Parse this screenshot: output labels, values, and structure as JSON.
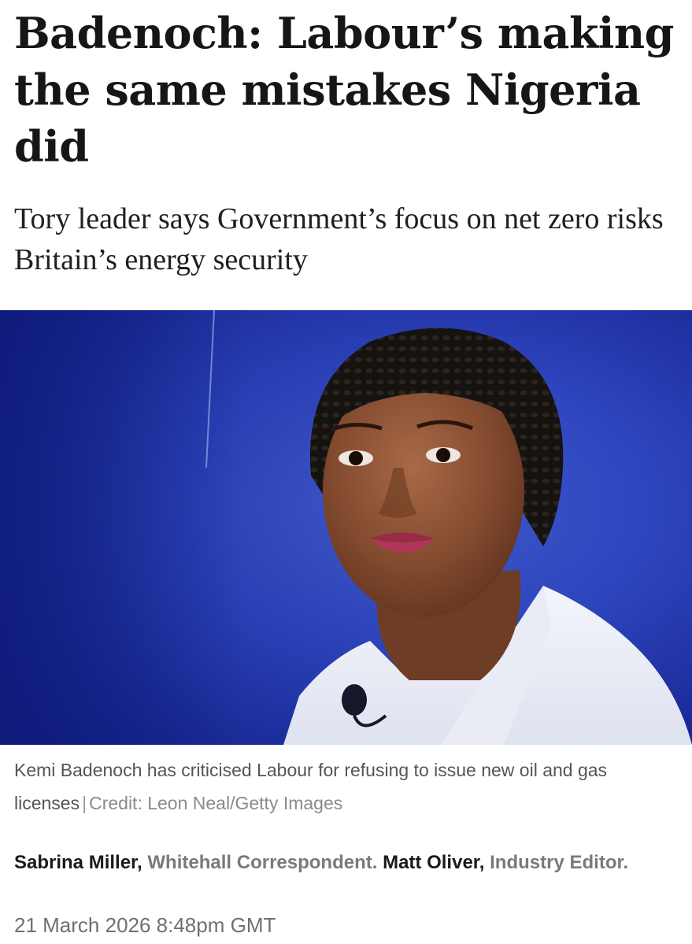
{
  "article": {
    "headline": "Badenoch: Labour’s making the same mistakes Nigeria did",
    "standfirst": "Tory leader says Government’s focus on net zero risks Britain’s energy security",
    "image": {
      "subject": "portrait-photo"
    },
    "caption": {
      "text": "Kemi Badenoch has criticised Labour for refusing to issue new oil and gas licenses",
      "separator": "|",
      "credit": "Credit: Leon Neal/Getty Images"
    },
    "byline": {
      "author1_name": "Sabrina Miller,",
      "author1_role": "Whitehall Correspondent.",
      "author2_name": "Matt Oliver,",
      "author2_role": "Industry Editor."
    },
    "date": "21 March 2026 8:48pm GMT"
  },
  "colors": {
    "background_blue": "#2a3fb0",
    "text_dark": "#161616",
    "text_muted": "#7a7a7a"
  }
}
